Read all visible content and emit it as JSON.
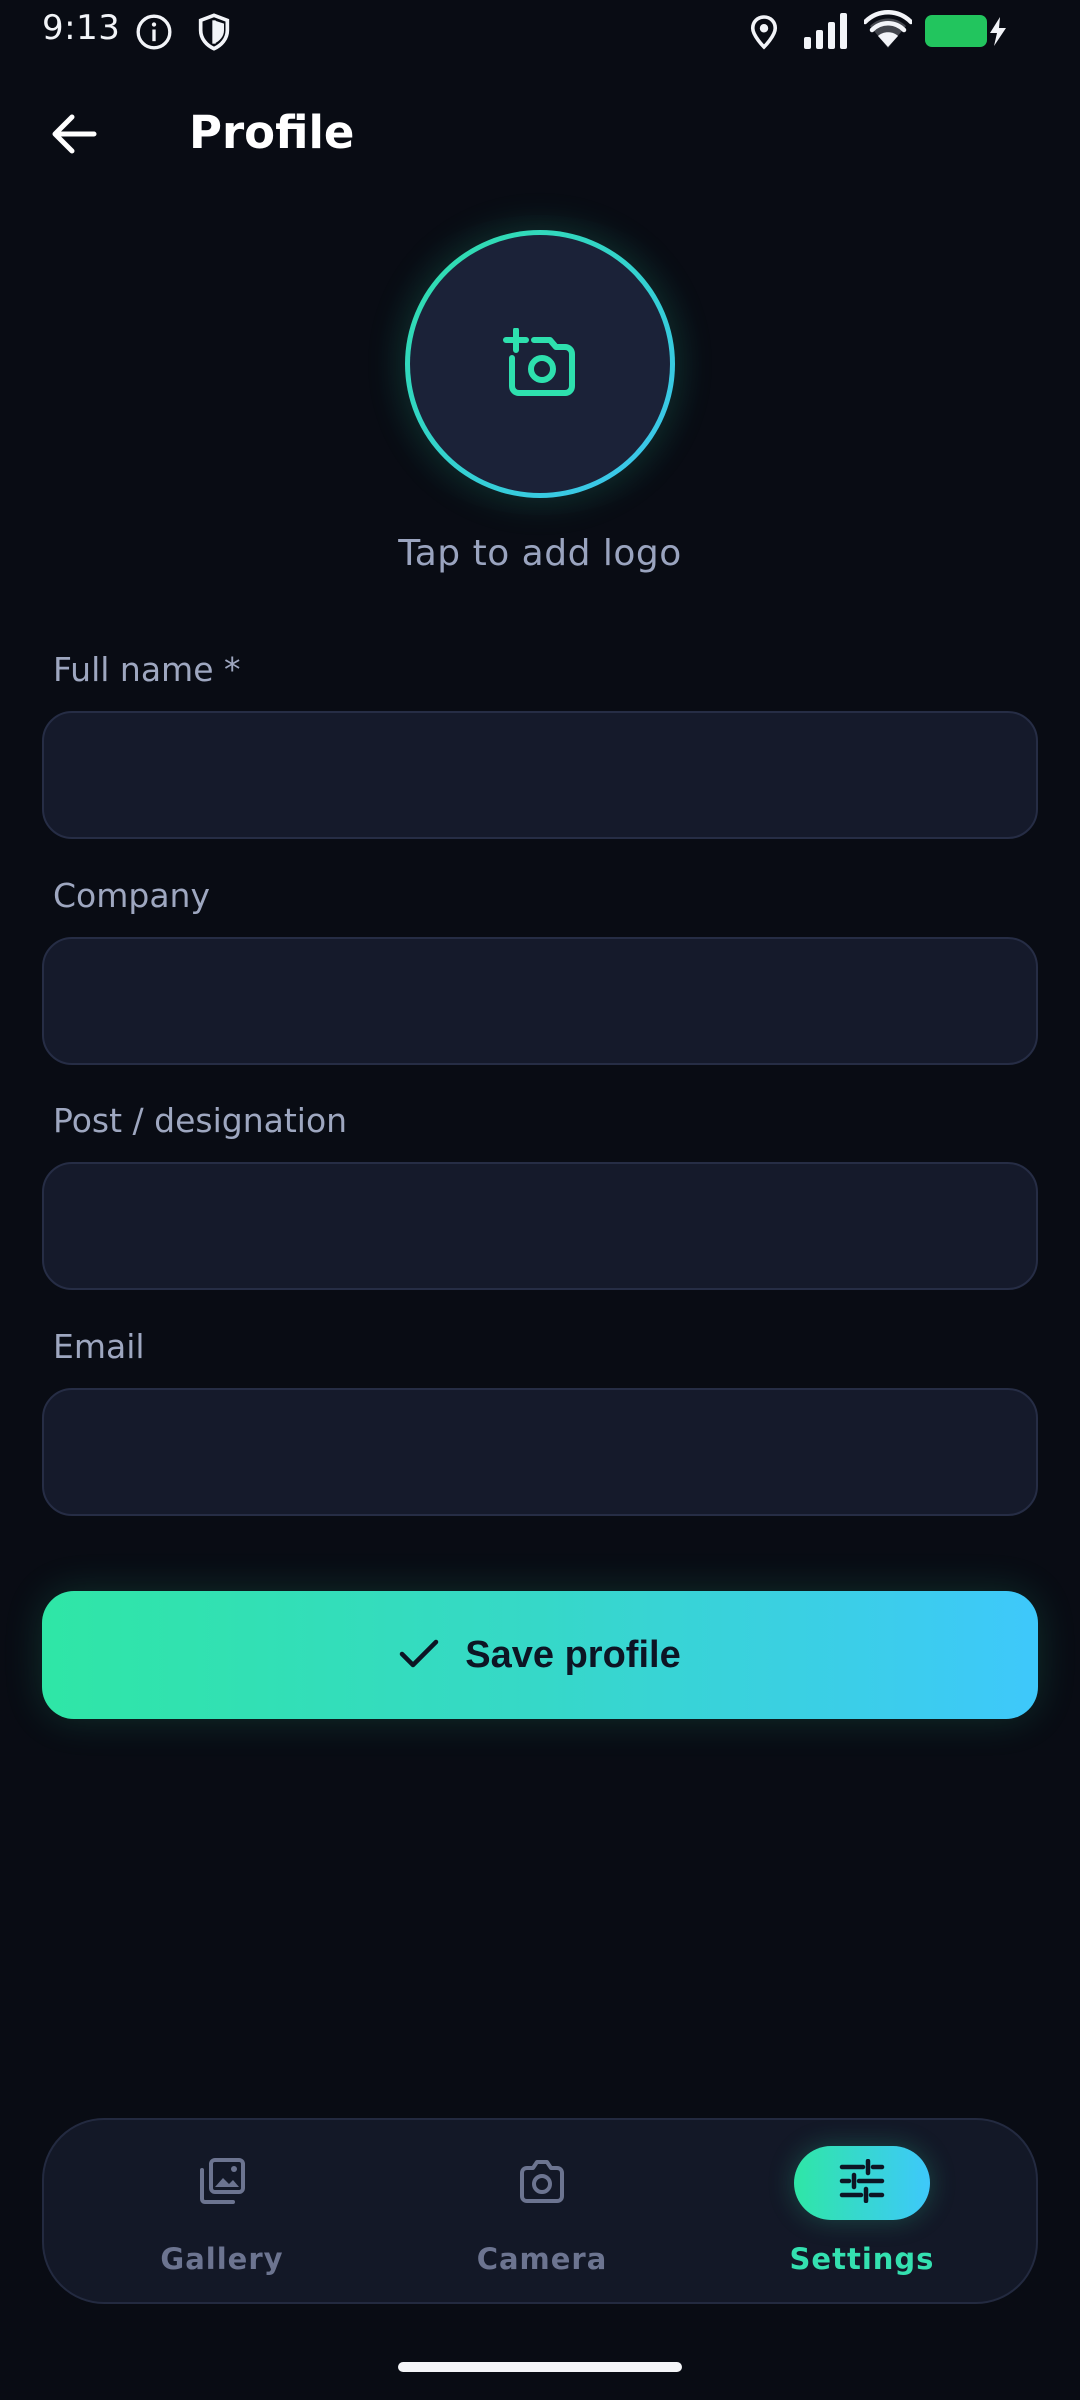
{
  "status_bar": {
    "time": "9:13",
    "left_icons": [
      "info-icon",
      "shield-icon"
    ],
    "right_icons": [
      "location-icon",
      "signal-icon",
      "wifi-icon",
      "battery-charging-icon"
    ],
    "battery_color": "#22c55e"
  },
  "app_bar": {
    "back_icon": "arrow-left-icon",
    "title": "Profile"
  },
  "logo": {
    "icon": "add-photo-icon",
    "caption": "Tap to add logo"
  },
  "form": {
    "fields": [
      {
        "label": "Full name *",
        "value": "",
        "placeholder": ""
      },
      {
        "label": "Company",
        "value": "",
        "placeholder": ""
      },
      {
        "label": "Post / designation",
        "value": "",
        "placeholder": ""
      },
      {
        "label": "Email",
        "value": "",
        "placeholder": ""
      }
    ],
    "save_label": "Save profile",
    "save_icon": "check-icon"
  },
  "bottom_nav": {
    "items": [
      {
        "label": "Gallery",
        "icon": "gallery-icon",
        "active": false
      },
      {
        "label": "Camera",
        "icon": "camera-icon",
        "active": false
      },
      {
        "label": "Settings",
        "icon": "tune-icon",
        "active": true
      }
    ]
  },
  "colors": {
    "background": "#090c14",
    "accent_start": "#2fe6a6",
    "accent_end": "#3ec8fb",
    "input_bg": "#151a2b",
    "label": "#9ea7c0"
  }
}
